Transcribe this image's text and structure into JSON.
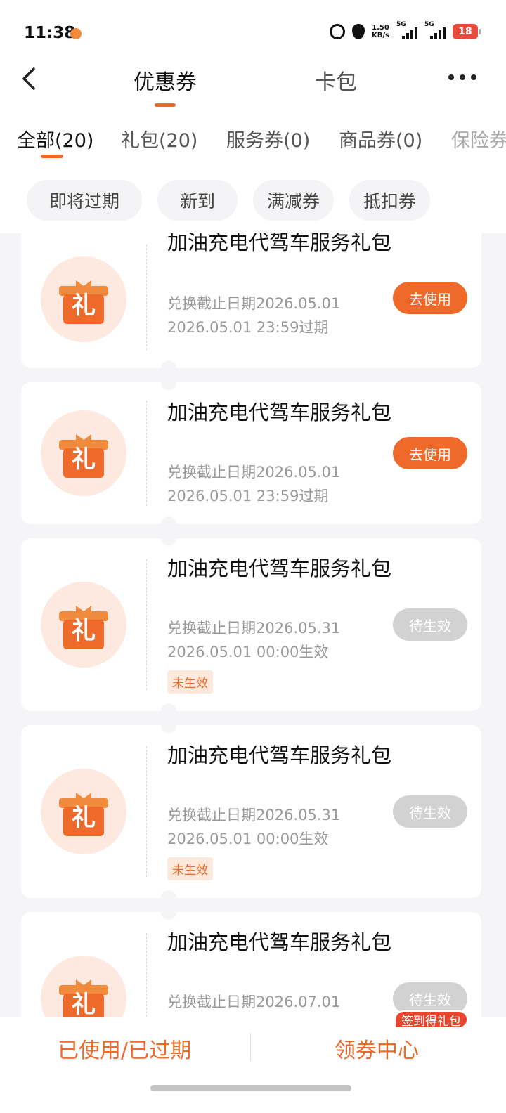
{
  "status_bar": {
    "time": "11:38",
    "net_speed_value": "1.50",
    "net_speed_unit": "KB/s",
    "signal1_label": "5G",
    "signal2_label": "5G",
    "battery": "18"
  },
  "header": {
    "tabs": [
      {
        "label": "优惠券",
        "active": true
      },
      {
        "label": "卡包",
        "active": false
      }
    ]
  },
  "category_tabs": [
    {
      "label": "全部(20)",
      "active": true
    },
    {
      "label": "礼包(20)",
      "active": false
    },
    {
      "label": "服务券(0)",
      "active": false
    },
    {
      "label": "商品券(0)",
      "active": false
    },
    {
      "label": "保险券",
      "active": false
    }
  ],
  "filters": [
    {
      "label": "即将过期"
    },
    {
      "label": "新到"
    },
    {
      "label": "满减券"
    },
    {
      "label": "抵扣券"
    }
  ],
  "coupons": [
    {
      "icon_char": "礼",
      "title": "加油充电代驾车服务礼包",
      "deadline": "兑换截止日期2026.05.01",
      "expire": "2026.05.01 23:59过期",
      "tag": "",
      "button": "去使用",
      "button_state": "active"
    },
    {
      "icon_char": "礼",
      "title": "加油充电代驾车服务礼包",
      "deadline": "兑换截止日期2026.05.01",
      "expire": "2026.05.01 23:59过期",
      "tag": "",
      "button": "去使用",
      "button_state": "active"
    },
    {
      "icon_char": "礼",
      "title": "加油充电代驾车服务礼包",
      "deadline": "兑换截止日期2026.05.31",
      "expire": "2026.05.01 00:00生效",
      "tag": "未生效",
      "button": "待生效",
      "button_state": "pending"
    },
    {
      "icon_char": "礼",
      "title": "加油充电代驾车服务礼包",
      "deadline": "兑换截止日期2026.05.31",
      "expire": "2026.05.01 00:00生效",
      "tag": "未生效",
      "button": "待生效",
      "button_state": "pending"
    },
    {
      "icon_char": "礼",
      "title": "加油充电代驾车服务礼包",
      "deadline": "兑换截止日期2026.07.01",
      "expire": "",
      "tag": "",
      "button": "待生效",
      "button_state": "pending"
    }
  ],
  "bottom_bar": {
    "used_expired": "已使用/已过期",
    "coupon_center": "领券中心",
    "checkin_badge": "签到得礼包"
  },
  "colors": {
    "accent": "#ef6a2a",
    "pending_button": "#d2d2d2",
    "gift_bg": "#fde9df",
    "page_bg": "#f5f5f7"
  }
}
